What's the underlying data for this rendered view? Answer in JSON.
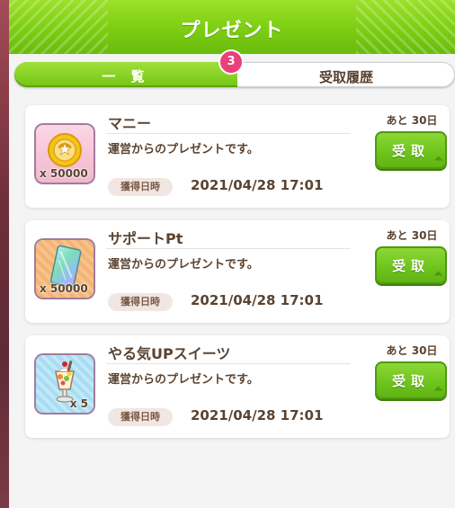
{
  "header": {
    "title": "プレゼント"
  },
  "tabs": {
    "list_label": "一 覧",
    "history_label": "受取履歴",
    "badge_count": "3"
  },
  "presents": [
    {
      "name": "マニー",
      "icon": "money-coin-icon",
      "quantity": "x 50000",
      "description": "運営からのプレゼントです。",
      "date_label": "獲得日時",
      "date": "2021/04/28 17:01",
      "remaining": "あと 30日",
      "button_label": "受取"
    },
    {
      "name": "サポートPt",
      "icon": "support-pt-card-icon",
      "quantity": "x 50000",
      "description": "運営からのプレゼントです。",
      "date_label": "獲得日時",
      "date": "2021/04/28 17:01",
      "remaining": "あと 30日",
      "button_label": "受取"
    },
    {
      "name": "やる気UPスイーツ",
      "icon": "parfait-icon",
      "quantity": "x 5",
      "description": "運営からのプレゼントです。",
      "date_label": "獲得日時",
      "date": "2021/04/28 17:01",
      "remaining": "あと 30日",
      "button_label": "受取"
    }
  ],
  "colors": {
    "header_green": "#7ccd12",
    "button_green": "#6cc31b",
    "text_brown": "#5a4331",
    "badge_pink": "#ea3f7b"
  }
}
